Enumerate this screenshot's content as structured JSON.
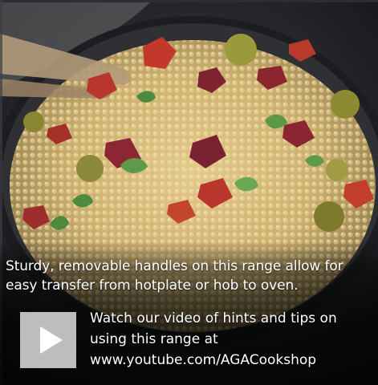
{
  "photo": {
    "subject": "couscous-salad-bowl-photo"
  },
  "caption": {
    "line1": "Sturdy, removable handles on this range allow for",
    "line2": "easy transfer from hotplate or hob to oven."
  },
  "video": {
    "icon": "play-icon",
    "line1": "Watch our video of hints and tips on",
    "line2": "using this range at",
    "link": "www.youtube.com/AGACookshop"
  },
  "colors": {
    "play_button": "#bdbdbd",
    "play_triangle": "#ffffff",
    "caption_text": "#ffffff"
  }
}
